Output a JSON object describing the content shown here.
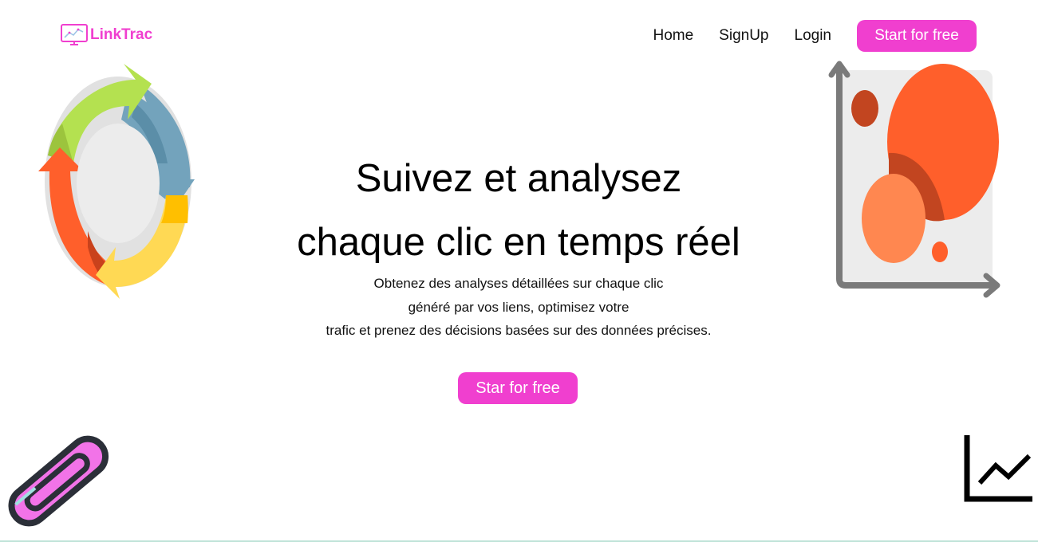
{
  "brand": {
    "name": "LinkTrac",
    "color": "#f03fcf"
  },
  "nav": {
    "items": [
      {
        "label": "Home"
      },
      {
        "label": "SignUp"
      },
      {
        "label": "Login"
      }
    ],
    "cta_label": "Start for free"
  },
  "hero": {
    "title_line1": "Suivez et analysez",
    "title_line2": "chaque clic en temps réel",
    "subtitle_line1": "Obtenez des analyses détaillées sur chaque clic",
    "subtitle_line2": "généré par vos liens, optimisez votre",
    "subtitle_line3": "trafic et prenez des décisions basées sur des données précises.",
    "cta_label": "Star for free"
  },
  "illustrations": {
    "top_left": "cycle-arrows-icon",
    "top_right": "bubble-chart-icon",
    "bottom_left": "paperclip-icon",
    "bottom_right": "line-chart-icon"
  }
}
